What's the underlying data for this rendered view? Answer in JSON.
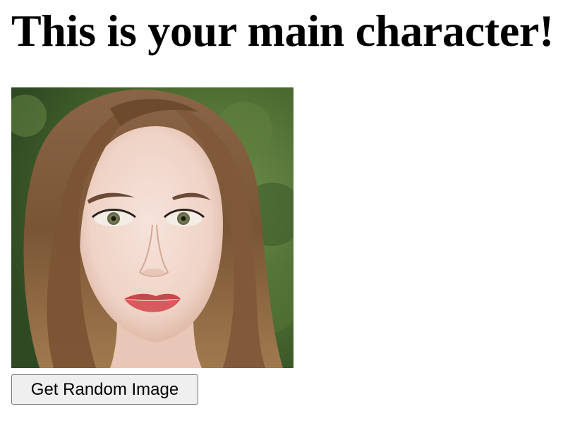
{
  "page": {
    "title": "This is your main character!"
  },
  "character_image": {
    "alt": "Portrait of a woman with long wavy light-brown hair against a green leafy background"
  },
  "controls": {
    "random_button_label": "Get Random Image"
  },
  "colors": {
    "background": "#ffffff",
    "button_background": "#efefef",
    "button_border": "#767676"
  }
}
